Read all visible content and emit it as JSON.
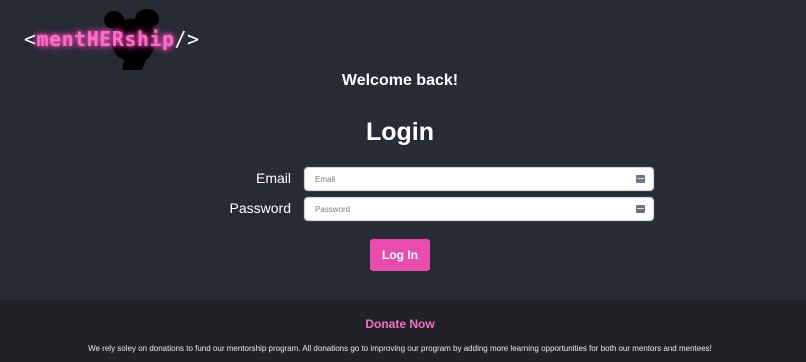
{
  "logo": {
    "open_bracket": "<",
    "word": "mentHERship",
    "close_bracket": "/>"
  },
  "welcome": "Welcome back!",
  "title": "Login",
  "form": {
    "email_label": "Email",
    "email_placeholder": "Email",
    "email_value": "",
    "password_label": "Password",
    "password_placeholder": "Password",
    "password_value": "",
    "field_icon": "password-manager-key-icon"
  },
  "login_button": "Log In",
  "footer": {
    "donate_label": "Donate Now",
    "message": "We rely soley on donations to fund our mentorship program. All donations go to improving our program by adding more learning opportunities for both our mentors and mentees!"
  },
  "colors": {
    "background": "#282b35",
    "accent": "#e84cae",
    "footer_bg": "#212227",
    "donate_text": "#f172c4"
  }
}
